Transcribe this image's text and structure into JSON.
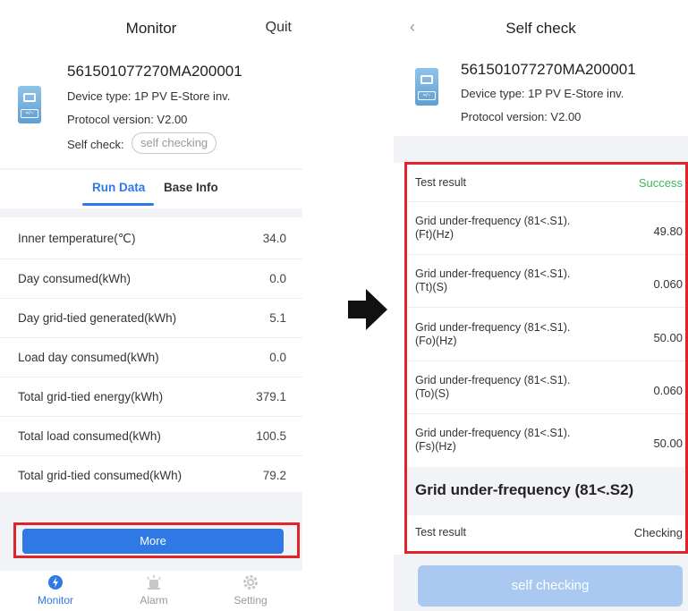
{
  "left": {
    "header": {
      "title": "Monitor",
      "quit_label": "Quit"
    },
    "device": {
      "serial": "561501077270MA200001",
      "device_type": "Device type: 1P PV E-Store inv.",
      "protocol": "Protocol version: V2.00",
      "self_check_label": "Self check:",
      "self_check_chip": "self checking",
      "icon_label": "=/~"
    },
    "tabs": [
      {
        "label": "Run Data",
        "active": true
      },
      {
        "label": "Base Info",
        "active": false
      }
    ],
    "rows": [
      {
        "label": "Inner temperature(℃)",
        "value": "34.0"
      },
      {
        "label": "Day consumed(kWh)",
        "value": "0.0"
      },
      {
        "label": "Day grid-tied generated(kWh)",
        "value": "5.1"
      },
      {
        "label": "Load day consumed(kWh)",
        "value": "0.0"
      },
      {
        "label": "Total grid-tied energy(kWh)",
        "value": "379.1"
      },
      {
        "label": "Total load consumed(kWh)",
        "value": "100.5"
      },
      {
        "label": "Total grid-tied consumed(kWh)",
        "value": "79.2"
      }
    ],
    "more_label": "More",
    "nav": [
      {
        "label": "Monitor",
        "icon": "monitor-icon",
        "active": true
      },
      {
        "label": "Alarm",
        "icon": "alarm-icon",
        "active": false
      },
      {
        "label": "Setting",
        "icon": "gear-icon",
        "active": false
      }
    ]
  },
  "right": {
    "header": {
      "title": "Self check",
      "back_icon": "chevron-left-icon"
    },
    "device": {
      "serial": "561501077270MA200001",
      "device_type": "Device type: 1P PV E-Store inv.",
      "protocol": "Protocol version: V2.00",
      "icon_label": "=/~"
    },
    "results": [
      {
        "label": "Test result",
        "value": "Success"
      },
      {
        "label": "Grid under-frequency (81<.S1).\n(Ft)(Hz)",
        "value": "49.80"
      },
      {
        "label": "Grid under-frequency (81<.S1).\n(Tt)(S)",
        "value": "0.060"
      },
      {
        "label": "Grid under-frequency (81<.S1).\n(Fo)(Hz)",
        "value": "50.00"
      },
      {
        "label": "Grid under-frequency (81<.S1).\n(To)(S)",
        "value": "0.060"
      },
      {
        "label": "Grid under-frequency (81<.S1).\n(Fs)(Hz)",
        "value": "50.00"
      }
    ],
    "section_title": "Grid under-frequency (81<.S2)",
    "section_result": {
      "label": "Test result",
      "value": "Checking"
    },
    "button_label": "self checking"
  },
  "colors": {
    "accent": "#2f79e6",
    "highlight": "#e3232a",
    "success": "#3cb85a",
    "background_grey": "#f2f3f7",
    "disabled_button": "#a9c9f1"
  }
}
